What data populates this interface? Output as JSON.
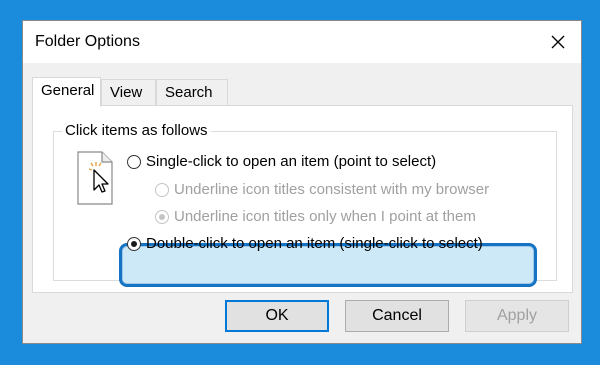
{
  "dialog": {
    "title": "Folder Options",
    "close_icon": "close-icon"
  },
  "tabs": [
    {
      "label": "General",
      "active": true
    },
    {
      "label": "View",
      "active": false
    },
    {
      "label": "Search",
      "active": false
    }
  ],
  "group": {
    "label": "Click items as follows",
    "icon": "document-cursor-icon",
    "options": [
      {
        "label": "Single-click to open an item (point to select)",
        "checked": false,
        "enabled": true
      },
      {
        "label": "Underline icon titles consistent with my browser",
        "checked": false,
        "enabled": false
      },
      {
        "label": "Underline icon titles only when I point at them",
        "checked": true,
        "enabled": false
      },
      {
        "label": "Double-click to open an item (single-click to select)",
        "checked": true,
        "enabled": true
      }
    ]
  },
  "buttons": {
    "ok": "OK",
    "cancel": "Cancel",
    "apply": "Apply"
  },
  "colors": {
    "background": "#1a8cdb",
    "highlight_border": "#1673c4",
    "highlight_fill": "#cde8f7",
    "default_button_border": "#0078d7"
  }
}
